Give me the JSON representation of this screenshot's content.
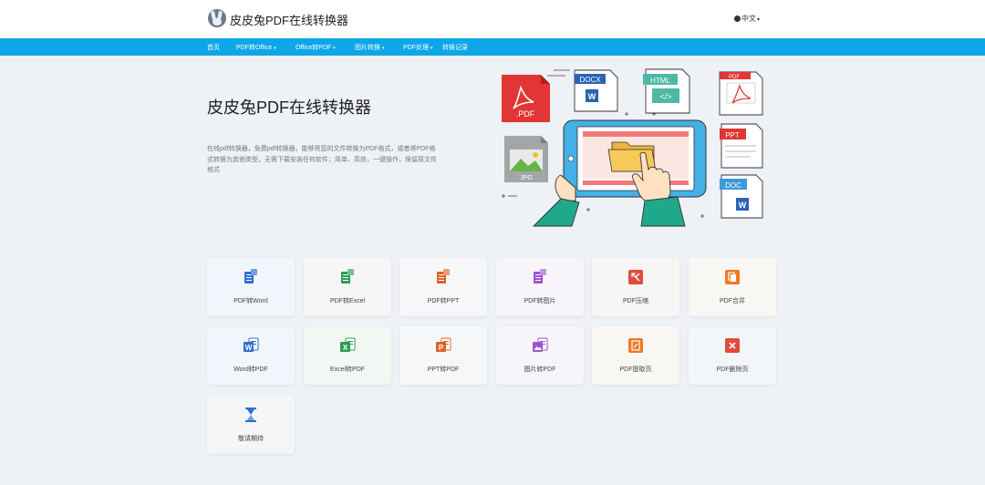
{
  "header": {
    "site_title": "皮皮兔PDF在线转换器",
    "language": "中文"
  },
  "nav": {
    "items": [
      {
        "label": "首页",
        "dropdown": false
      },
      {
        "label": "PDF转Office",
        "dropdown": true
      },
      {
        "label": "Office转PDF",
        "dropdown": true
      },
      {
        "label": "图片转换",
        "dropdown": true
      },
      {
        "label": "PDF处理",
        "dropdown": true
      },
      {
        "label": "转换记录",
        "dropdown": false
      }
    ]
  },
  "hero": {
    "title": "皮皮兔PDF在线转换器",
    "description": "在线pdf转换器，免费pdf转换器，能够将您的文件转换为PDF格式，或者将PDF格式转换为其他类型，无需下载安装任何软件；简单、高效，一键操作，保留原文件格式",
    "illustration_labels": {
      "pdf": ".PDF",
      "docx": "DOCX",
      "html": "HTML",
      "pdf_small": "PDF",
      "jpg": "JPG",
      "ppt": "PPT",
      "doc": "DOC",
      "w": "W",
      "code": "</>"
    }
  },
  "tools": [
    {
      "label": "PDF转Word",
      "icon": "pdf-to-word-icon",
      "color": "#2f6fd0",
      "bg": "#f1f6fc"
    },
    {
      "label": "PDF转Excel",
      "icon": "pdf-to-excel-icon",
      "color": "#2a9d56",
      "bg": "#f5f6f5"
    },
    {
      "label": "PDF转PPT",
      "icon": "pdf-to-ppt-icon",
      "color": "#e0622a",
      "bg": "#f6f7f8"
    },
    {
      "label": "PDF转图片",
      "icon": "pdf-to-image-icon",
      "color": "#9b56c9",
      "bg": "#f7f5fa"
    },
    {
      "label": "PDF压缩",
      "icon": "pdf-compress-icon",
      "color": "#e24b3b",
      "bg": "#f8f6f5"
    },
    {
      "label": "PDF合并",
      "icon": "pdf-merge-icon",
      "color": "#ef7b24",
      "bg": "#f8f7f4"
    },
    {
      "label": "Word转PDF",
      "icon": "word-to-pdf-icon",
      "color": "#2f6fd0",
      "bg": "#f1f6fc"
    },
    {
      "label": "Excel转PDF",
      "icon": "excel-to-pdf-icon",
      "color": "#2a9d56",
      "bg": "#f3f7f4"
    },
    {
      "label": "PPT转PDF",
      "icon": "ppt-to-pdf-icon",
      "color": "#e0622a",
      "bg": "#f6f7f8"
    },
    {
      "label": "图片转PDF",
      "icon": "image-to-pdf-icon",
      "color": "#9b56c9",
      "bg": "#f7f5fa"
    },
    {
      "label": "PDF提取页",
      "icon": "pdf-extract-icon",
      "color": "#ef7b24",
      "bg": "#f8f7f4"
    },
    {
      "label": "PDF删除页",
      "icon": "pdf-delete-icon",
      "color": "#e24b3b",
      "bg": "#f3f6f9"
    },
    {
      "label": "敬请期待",
      "icon": "hourglass-icon",
      "color": "#2f6fd0",
      "bg": "#f4f5f7"
    }
  ]
}
